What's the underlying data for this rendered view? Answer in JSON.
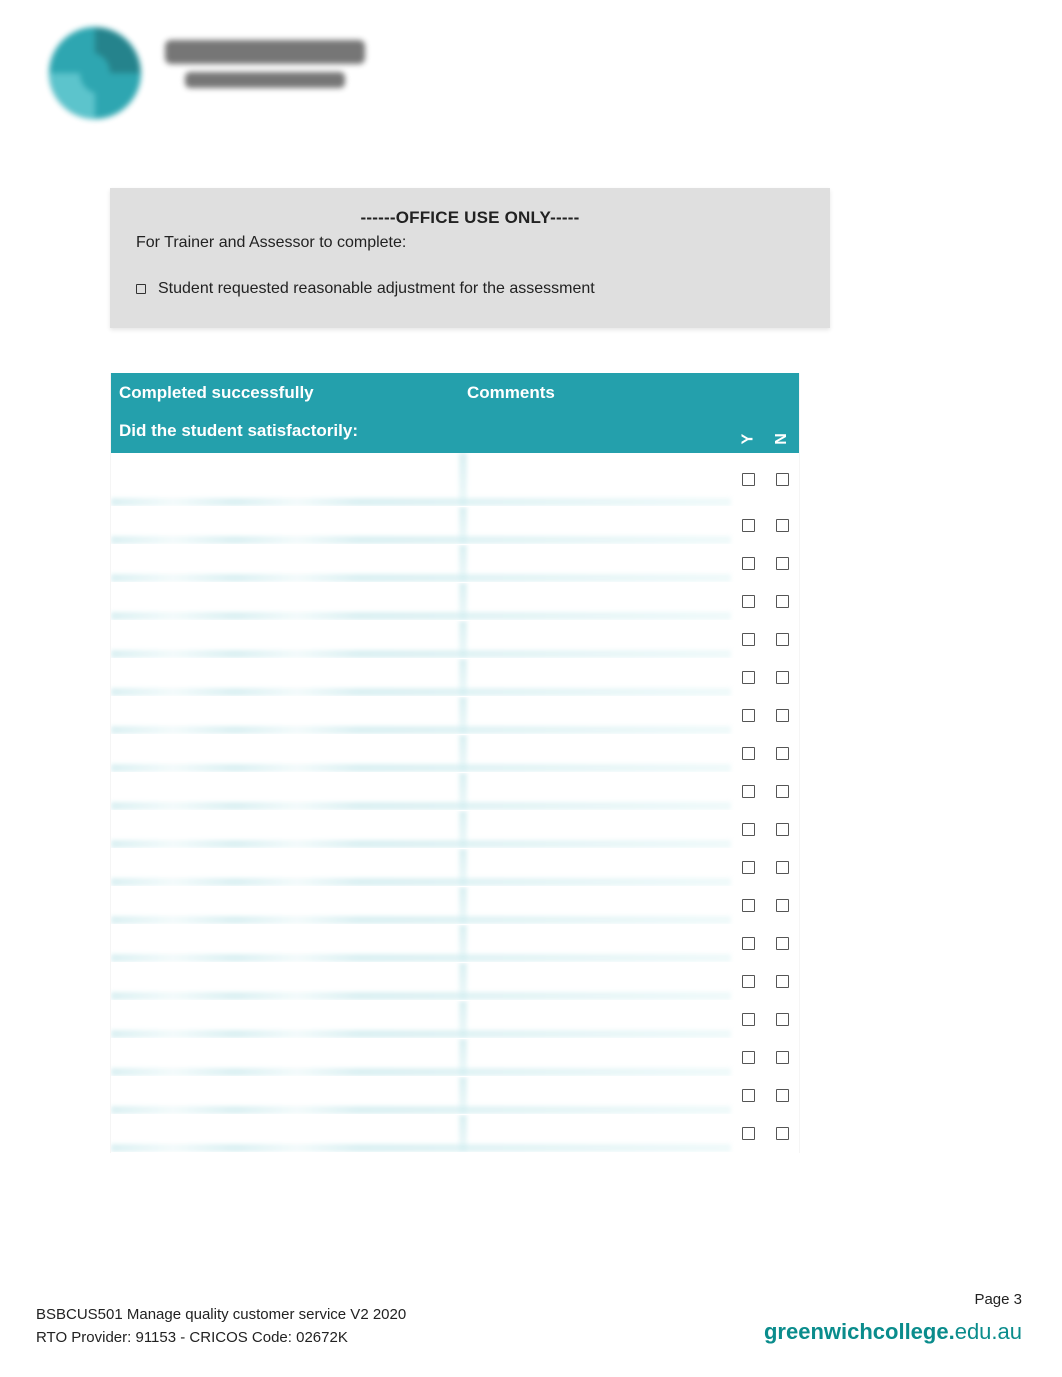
{
  "header": {
    "logo_alt": "Greenwich Management College"
  },
  "office": {
    "title": "------OFFICE USE ONLY-----",
    "subtitle": "For Trainer and Assessor to complete:",
    "adjustment_label": "Student requested reasonable adjustment for the assessment"
  },
  "table": {
    "col_completed": "Completed successfully",
    "col_comments": "Comments",
    "col_question": "Did the student satisfactorily:",
    "col_y": "Y",
    "col_n": "N",
    "row_count": 18
  },
  "footer": {
    "left_line1": "BSBCUS501 Manage quality customer service V2 2020",
    "left_line2": "RTO Provider: 91153  - CRICOS  Code: 02672K",
    "page_label": "Page 3",
    "url_bold": "greenwichcollege.",
    "url_rest": "edu.au"
  }
}
